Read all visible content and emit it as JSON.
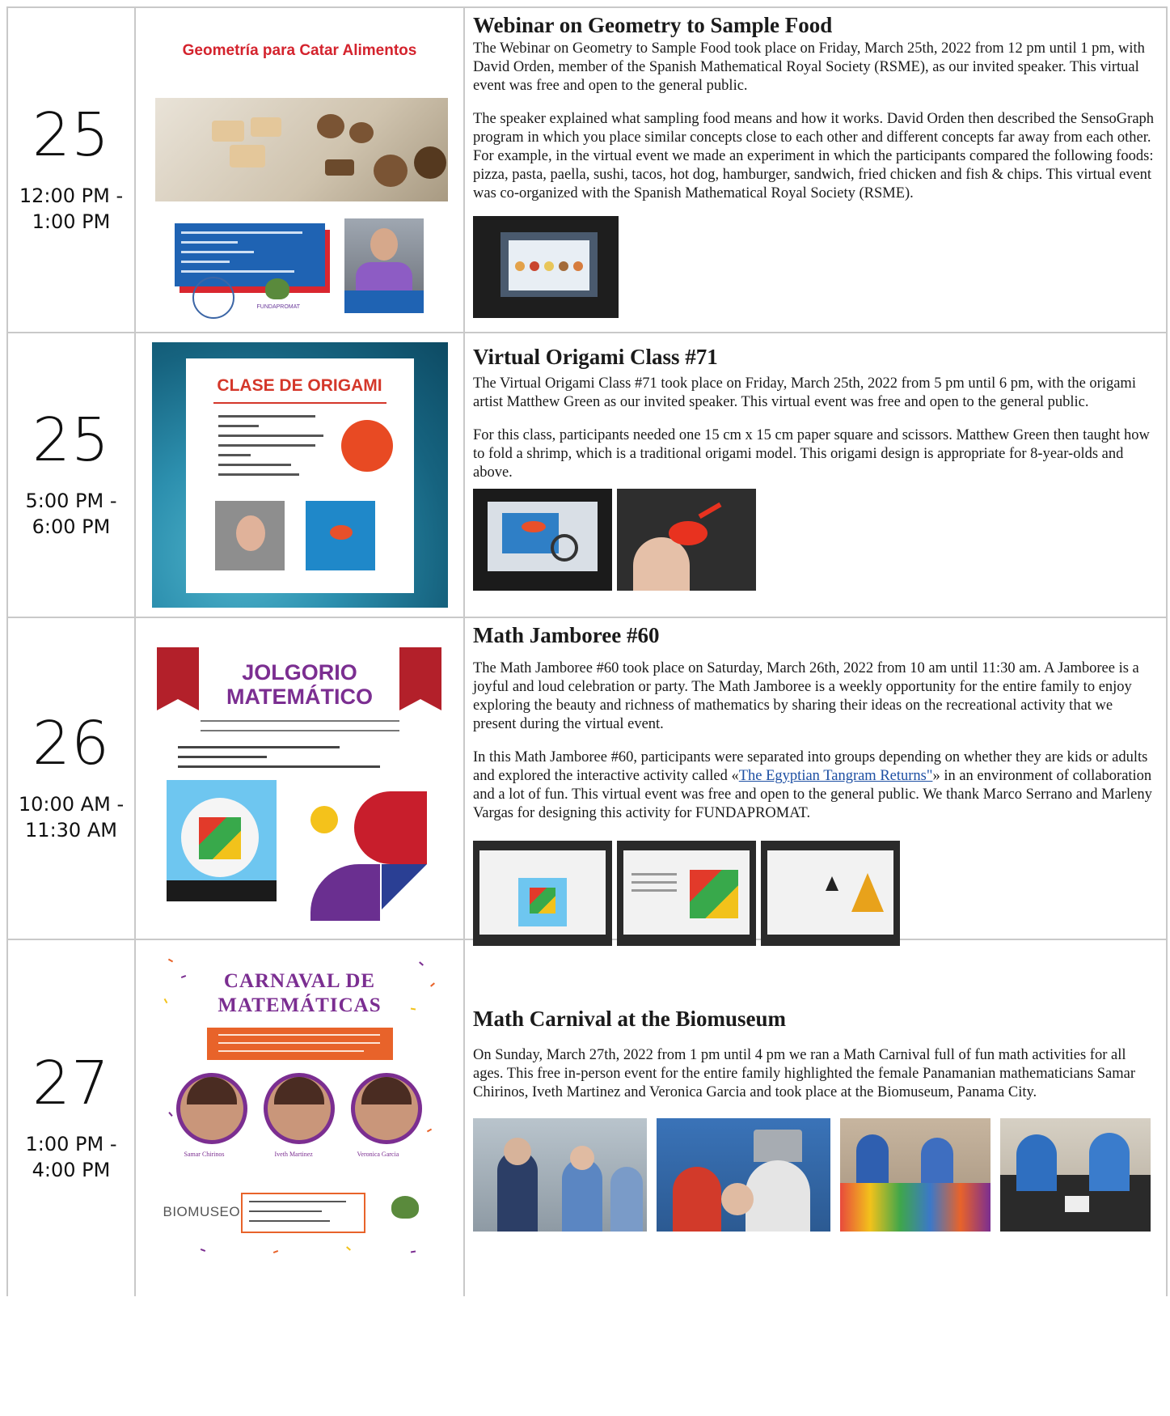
{
  "events": [
    {
      "day": "25",
      "time": "12:00 PM -\n1:00 PM",
      "title": "Webinar on Geometry to Sample Food",
      "paragraphs": [
        "The Webinar on Geometry to Sample Food took place on Friday, March 25th, 2022 from 12 pm until 1 pm, with David Orden, member of the Spanish Mathematical Royal Society (RSME), as our invited speaker. This virtual event was free and open to the general public.",
        "The speaker explained what sampling food means and how it works. David Orden then described the SensoGraph program in which you place similar concepts close to each other and different concepts far away from each other. For example, in the virtual event we made an experiment in which the participants compared the following foods: pizza, pasta, paella, sushi, tacos, hot dog, hamburger, sandwich, fried chicken and fish & chips. This virtual event was co-organized with the Spanish Mathematical Royal Society (RSME)."
      ],
      "poster_title": "Geometría para Catar Alimentos"
    },
    {
      "day": "25",
      "time": "5:00 PM -\n6:00 PM",
      "title": "Virtual Origami Class #71",
      "paragraphs": [
        "The Virtual Origami Class #71 took place on Friday, March 25th, 2022 from 5 pm until 6 pm, with the origami artist Matthew Green as our invited speaker. This virtual event was free and open to the general public.",
        "For this class, participants needed one 15 cm x 15 cm paper square and scissors. Matthew Green then taught how to fold a shrimp, which is a traditional origami model. This origami design is appropriate for 8-year-olds and above."
      ],
      "poster_title": "CLASE DE ORIGAMI"
    },
    {
      "day": "26",
      "time": "10:00 AM -\n11:30 AM",
      "title": "Math Jamboree #60",
      "paragraphs": [
        "The Math Jamboree #60 took place on Saturday, March 26th, 2022 from 10 am until 11:30 am. A Jamboree is a joyful and loud celebration or party. The Math Jamboree is a weekly opportunity for the entire family to enjoy exploring the beauty and richness of mathematics by sharing their ideas on the recreational activity that we present during the virtual event."
      ],
      "p2_before": "In this Math Jamboree #60, participants were separated into groups depending on whether they are kids or adults and explored the interactive activity called «",
      "p2_link": "The Egyptian Tangram Returns\"",
      "p2_after": "» in an environment of collaboration and a lot of fun. This virtual event was free and open to the general public. We thank Marco Serrano and Marleny Vargas for designing this activity for FUNDAPROMAT.",
      "poster_title": "JOLGORIO\nMATEMÁTICO"
    },
    {
      "day": "27",
      "time": "1:00 PM -\n4:00 PM",
      "title": "Math Carnival at the Biomuseum",
      "paragraphs": [
        "On Sunday, March 27th, 2022 from 1 pm until 4 pm we ran a Math Carnival full of fun math activities for all ages. This free in-person event for the entire family highlighted the female Panamanian mathematicians Samar Chirinos, Iveth Martinez and Veronica Garcia and took place at the Biomuseum, Panama City."
      ],
      "poster_title": "CARNAVAL DE\nMATEMÁTICAS",
      "poster_names": [
        "Samar Chirinos",
        "Iveth Martinez",
        "Veronica Garcia"
      ],
      "poster_logo": "BIOMUSEO"
    }
  ],
  "colors": {
    "border": "#c9c9c9",
    "link": "#1d4fa3",
    "accent_purple": "#7b2e91",
    "accent_red": "#d4232d"
  }
}
